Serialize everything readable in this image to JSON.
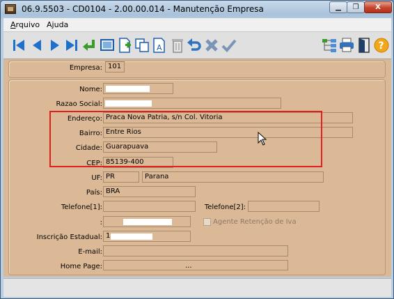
{
  "window": {
    "title": "06.9.5503 - CD0104 - 2.00.00.014 - Manutenção Empresa",
    "minimize_symbol": "▁",
    "restore_symbol": "❐",
    "close_symbol": "X"
  },
  "menu": {
    "items": [
      {
        "label": "Arquivo"
      },
      {
        "label": "Ajuda"
      }
    ]
  },
  "toolbar": {
    "icons": [
      "first-record-icon",
      "previous-record-icon",
      "next-record-icon",
      "last-record-icon",
      "enter-icon",
      "preview-icon",
      "new-document-icon",
      "copy-icon",
      "edit-document-icon",
      "delete-icon",
      "undo-icon",
      "cancel-icon",
      "confirm-icon",
      "tree-icon",
      "print-icon",
      "exit-icon",
      "help-icon"
    ]
  },
  "form": {
    "empresa": {
      "label": "Empresa:",
      "value": "101"
    },
    "nome": {
      "label": "Nome:",
      "value": ""
    },
    "razao_social": {
      "label": "Razao Social:",
      "value": ""
    },
    "endereco": {
      "label": "Endereço:",
      "value": "Praca Nova Patria, s/n Col. Vitoria"
    },
    "bairro": {
      "label": "Bairro:",
      "value": "Entre Rios"
    },
    "cidade": {
      "label": "Cidade:",
      "value": "Guarapuava"
    },
    "cep": {
      "label": "CEP:",
      "value": "85139-400"
    },
    "uf": {
      "label": "UF:",
      "code": "PR",
      "name": "Parana"
    },
    "pais": {
      "label": "País:",
      "value": "BRA"
    },
    "telefone1": {
      "label": "Telefone[1]:",
      "value": ""
    },
    "telefone2": {
      "label": "Telefone[2]:",
      "value": ""
    },
    "masked_field": {
      "label": ":",
      "value": ""
    },
    "agente_retencao": {
      "label": "Agente Retenção de Iva",
      "checked": false
    },
    "inscricao_estadual": {
      "label": "Inscrição Estadual:",
      "value": "1"
    },
    "email": {
      "label": "E-mail:",
      "value": ""
    },
    "home_page": {
      "label": "Home Page:",
      "value": "..."
    }
  },
  "colors": {
    "form_bg": "#dbb996",
    "highlight": "#e01f1f",
    "toolbar_icon": "#1f6fcf"
  }
}
